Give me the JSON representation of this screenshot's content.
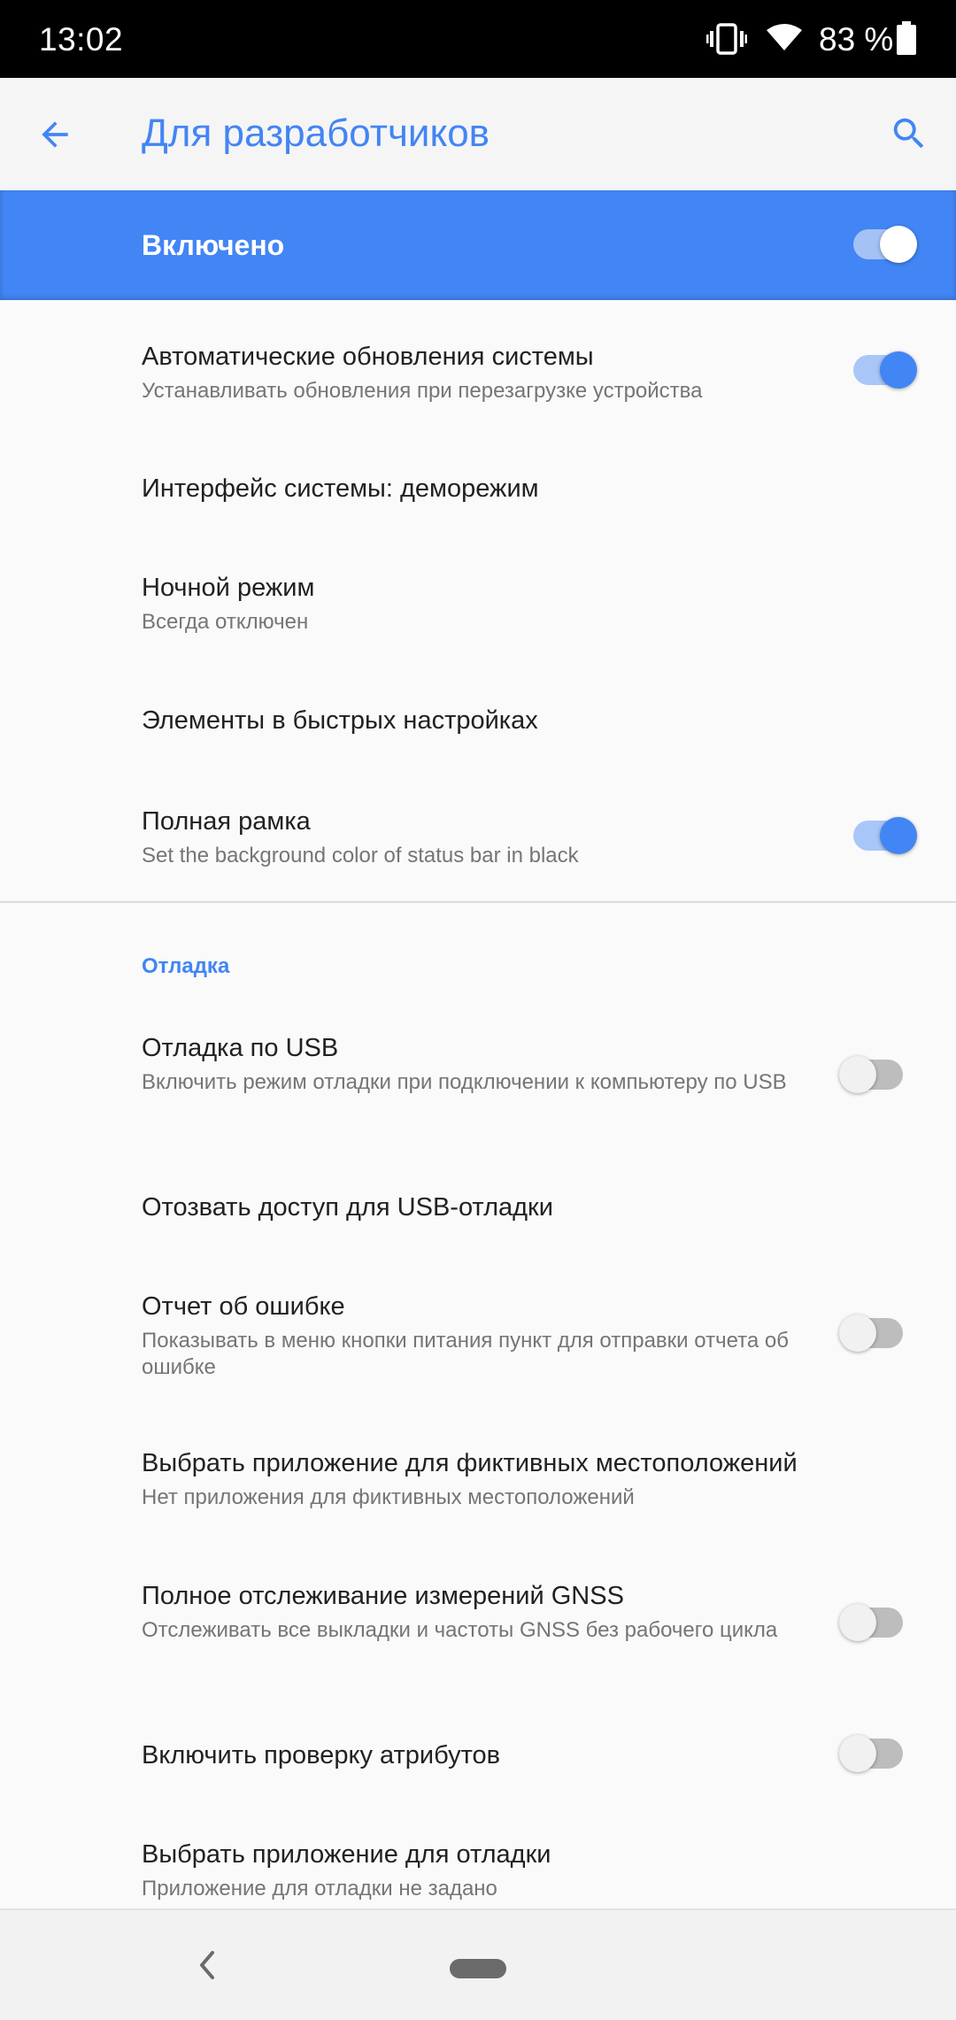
{
  "status_bar": {
    "time": "13:02",
    "battery_percent": "83 %",
    "icons": [
      "vibrate-icon",
      "wifi-icon",
      "battery-icon"
    ]
  },
  "app_bar": {
    "title": "Для разработчиков",
    "back_icon": "back-arrow-icon",
    "search_icon": "search-icon"
  },
  "master_switch": {
    "label": "Включено",
    "on": true
  },
  "colors": {
    "accent": "#4285f4",
    "background": "#fafafa",
    "status_bar": "#000000"
  },
  "settings": [
    {
      "title": "Автоматические обновления системы",
      "summary": "Устанавливать обновления при перезагрузке устройства",
      "toggle": "on"
    },
    {
      "title": "Интерфейс системы: деморежим",
      "summary": "",
      "toggle": "none"
    },
    {
      "title": "Ночной режим",
      "summary": "Всегда отключен",
      "toggle": "none"
    },
    {
      "title": "Элементы в быстрых настройках",
      "summary": "",
      "toggle": "none"
    },
    {
      "title": "Полная рамка",
      "summary": "Set the background color of status bar in black",
      "toggle": "on"
    }
  ],
  "debug_section": {
    "header": "Отладка",
    "items": [
      {
        "title": "Отладка по USB",
        "summary": "Включить режим отладки при подключении к компьютеру по USB",
        "toggle": "off"
      },
      {
        "title": "Отозвать доступ для USB-отладки",
        "summary": "",
        "toggle": "none"
      },
      {
        "title": "Отчет об ошибке",
        "summary": "Показывать в меню кнопки питания пункт для отправки отчета об ошибке",
        "toggle": "off"
      },
      {
        "title": "Выбрать приложение для фиктивных местоположений",
        "summary": "Нет приложения для фиктивных местоположений",
        "toggle": "none"
      },
      {
        "title": "Полное отслеживание измерений GNSS",
        "summary": "Отслеживать все выкладки и частоты GNSS без рабочего цикла",
        "toggle": "off"
      },
      {
        "title": "Включить проверку атрибутов",
        "summary": "",
        "toggle": "off"
      },
      {
        "title": "Выбрать приложение для отладки",
        "summary": "Приложение для отладки не задано",
        "toggle": "none"
      }
    ]
  },
  "nav_bar": {
    "back_icon": "nav-back-icon",
    "home_icon": "home-pill-icon"
  }
}
